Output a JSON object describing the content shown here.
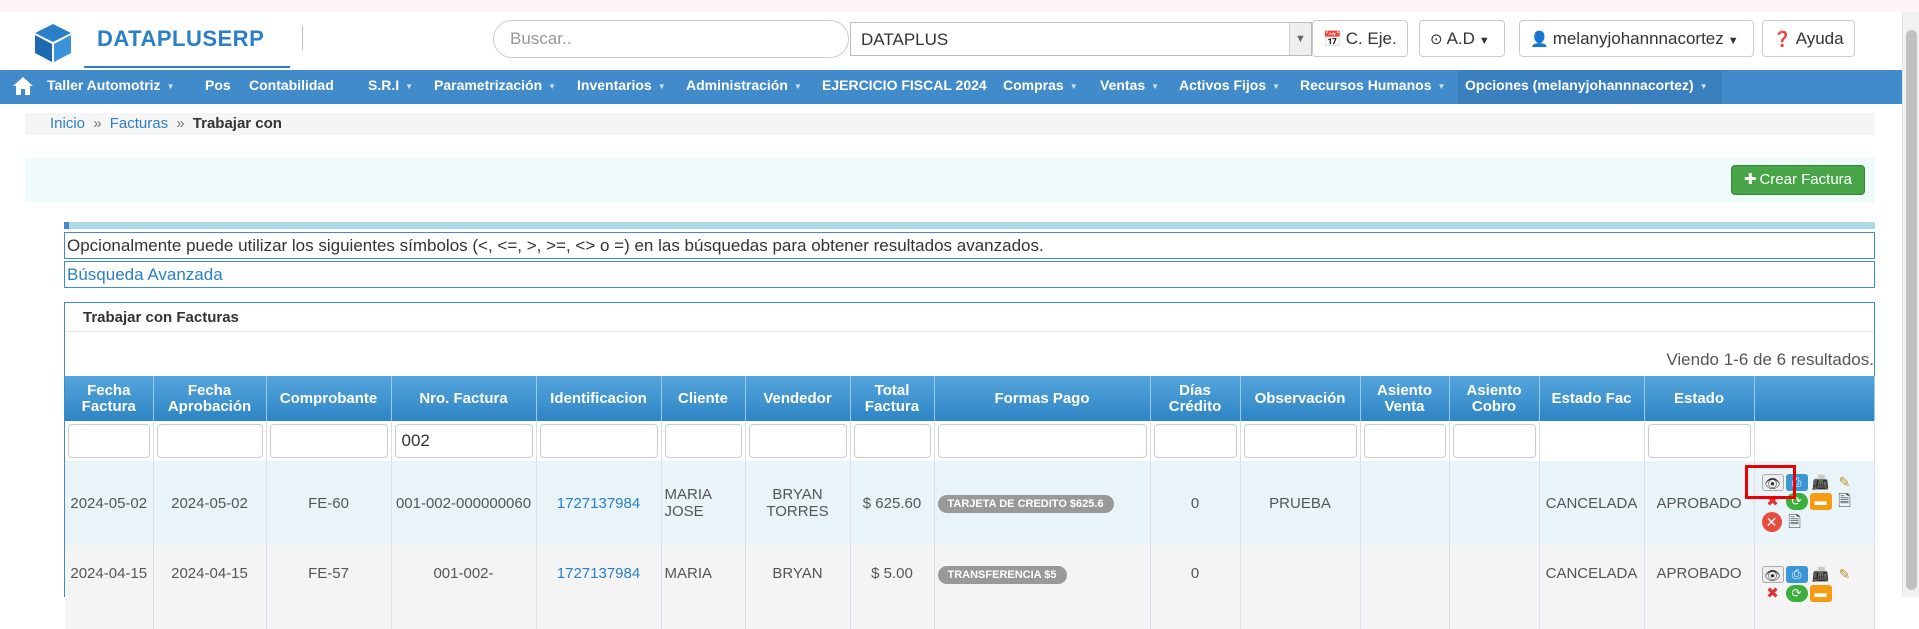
{
  "header": {
    "brand": "DATAPLUSERP",
    "search_placeholder": "Buscar..",
    "company_value": "DATAPLUS",
    "buttons": {
      "c_eje": "C. Eje.",
      "ad": "A.D",
      "user": "melanyjohannnacortez",
      "ayuda": "Ayuda"
    }
  },
  "nav": {
    "items": [
      "Taller Automotriz",
      "Pos",
      "Contabilidad",
      "S.R.I",
      "Parametrización",
      "Inventarios",
      "Administración",
      "EJERCICIO FISCAL 2024",
      "Compras",
      "Ventas",
      "Activos Fijos",
      "Recursos Humanos",
      "Opciones (melanyjohannnacortez)"
    ]
  },
  "breadcrumb": {
    "home": "Inicio",
    "section": "Facturas",
    "current": "Trabajar con",
    "sep": "»"
  },
  "actions": {
    "crear_label": "Crear Factura"
  },
  "note": "Opcionalmente puede utilizar los siguientes símbolos (<, <=, >, >=, <> o =) en las búsquedas para obtener resultados avanzados.",
  "advanced_search": "Búsqueda Avanzada",
  "panel": {
    "title": "Trabajar con Facturas",
    "summary": "Viendo 1-6 de 6 resultados."
  },
  "table": {
    "headers": [
      "Fecha Factura",
      "Fecha Aprobación",
      "Comprobante",
      "Nro. Factura",
      "Identificacion",
      "Cliente",
      "Vendedor",
      "Total Factura",
      "Formas Pago",
      "Días Crédito",
      "Observación",
      "Asiento Venta",
      "Asiento Cobro",
      "Estado Fac",
      "Estado",
      ""
    ],
    "filter_nro_factura": "002",
    "rows": [
      {
        "fecha_factura": "2024-05-02",
        "fecha_aprobacion": "2024-05-02",
        "comprobante": "FE-60",
        "nro_factura": "001-002-000000060",
        "identificacion": "1727137984",
        "cliente": "MARIA JOSE",
        "vendedor": "BRYAN TORRES",
        "total": "$ 625.60",
        "forma_pago": "TARJETA DE CREDITO $625.6",
        "dias_credito": "0",
        "observacion": "PRUEBA",
        "asiento_venta": "",
        "asiento_cobro": "",
        "estado_fac": "CANCELADA",
        "estado": "APROBADO"
      },
      {
        "fecha_factura": "2024-04-15",
        "fecha_aprobacion": "2024-04-15",
        "comprobante": "FE-57",
        "nro_factura": "001-002-",
        "identificacion": "1727137984",
        "cliente": "MARIA",
        "vendedor": "BRYAN",
        "total": "$ 5.00",
        "forma_pago": "TRANSFERENCIA $5",
        "dias_credito": "0",
        "observacion": "",
        "asiento_venta": "",
        "asiento_cobro": "",
        "estado_fac": "CANCELADA",
        "estado": "APROBADO"
      }
    ]
  },
  "colors": {
    "nav": "#428bca",
    "brand": "#2a7fc8",
    "crear": "#47a447",
    "highlight": "#e00000"
  }
}
